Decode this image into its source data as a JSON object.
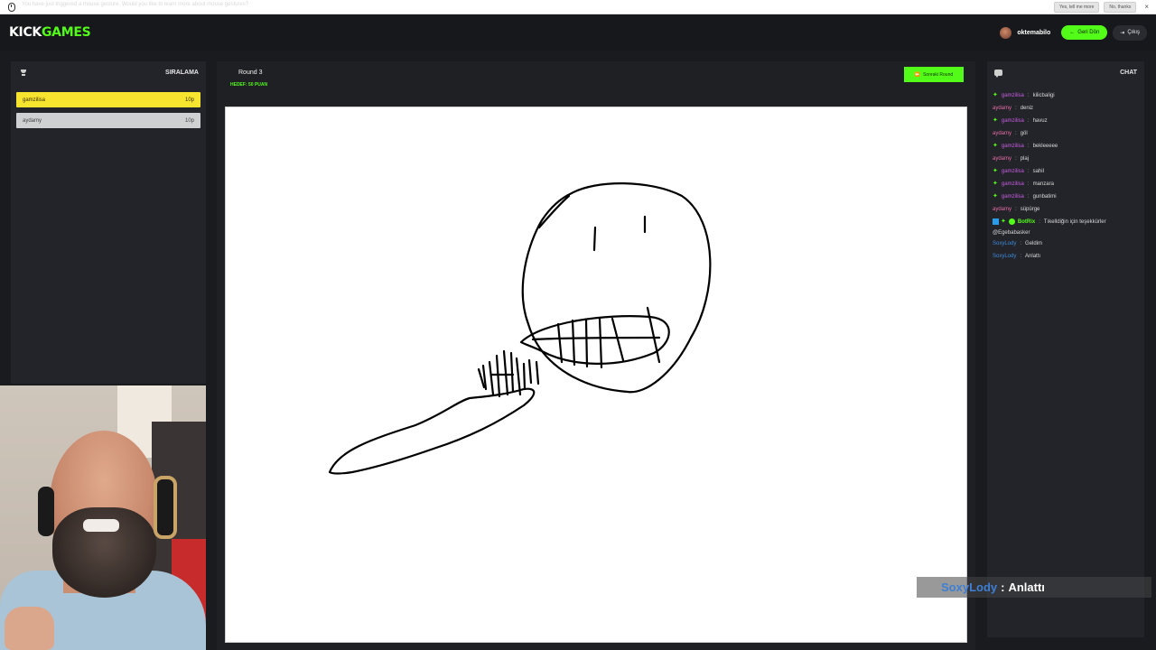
{
  "notification": {
    "message": "You have just triggered a mouse gesture. Would you like to learn more about mouse gestures?",
    "yes_label": "Yes, tell me more",
    "no_label": "No, thanks",
    "close": "×"
  },
  "header": {
    "logo_white": "KICK",
    "logo_green": "GAMES",
    "username": "oktemabilo",
    "back_label": "Geri Dön",
    "back_icon": "←",
    "exit_label": "Çıkış",
    "exit_icon": "⇥"
  },
  "leaderboard": {
    "title": "SIRALAMA",
    "players": [
      {
        "name": "gamzilisa",
        "points": "10p"
      },
      {
        "name": "aydamy",
        "points": "10p"
      }
    ]
  },
  "game": {
    "round_label": "Round 3",
    "goal_label": "HEDEF: 50 PUAN",
    "next_round_label": "Sonraki Round",
    "next_round_icon": "⏩"
  },
  "chat": {
    "title": "CHAT",
    "messages": [
      {
        "user": "gamzilisa",
        "text": "kilicbaligi"
      },
      {
        "user": "aydamy",
        "text": "deniz"
      },
      {
        "user": "gamzilisa",
        "text": "havuz"
      },
      {
        "user": "aydamy",
        "text": "göl"
      },
      {
        "user": "gamzilisa",
        "text": "bekleeeee"
      },
      {
        "user": "aydamy",
        "text": "plaj"
      },
      {
        "user": "gamzilisa",
        "text": "sahil"
      },
      {
        "user": "gamzilisa",
        "text": "manzara"
      },
      {
        "user": "gamzilisa",
        "text": "gunbatimi"
      },
      {
        "user": "aydamy",
        "text": "süpürge"
      },
      {
        "user": "BotRix",
        "text": "Tıkelldiğin için teşekkürler",
        "cont": "@Egebabasker"
      },
      {
        "user": "SoxyLody",
        "text": "Geldim"
      },
      {
        "user": "SoxyLody",
        "text": "Anlattı"
      }
    ]
  },
  "overlay": {
    "user": "SoxyLody",
    "colon": ":",
    "text": "Anlattı"
  },
  "colors": {
    "accent": "#53fc18",
    "first_place": "#f7e42e",
    "background": "#1a1b1f"
  }
}
